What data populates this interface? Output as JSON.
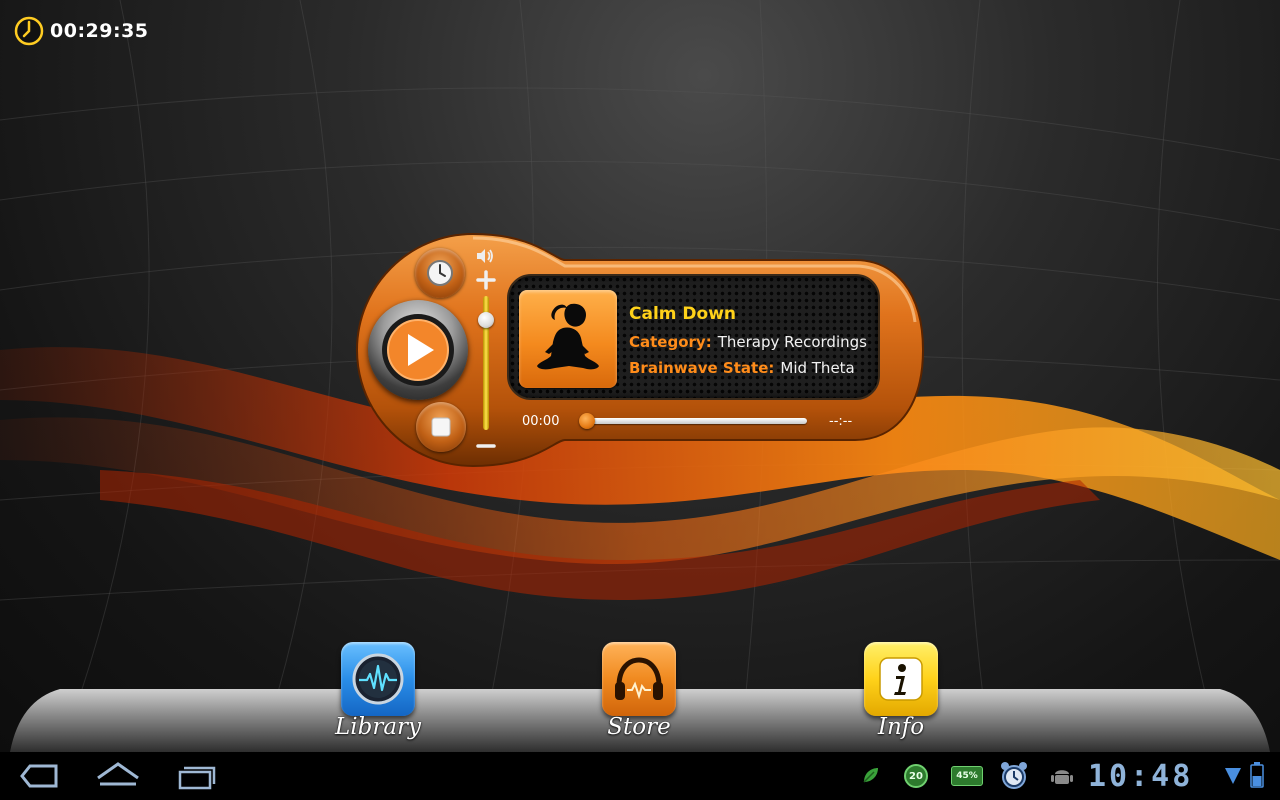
{
  "session": {
    "timer": "00:29:35",
    "timer_icon": "clock-icon"
  },
  "player": {
    "title": "Calm Down",
    "category_label": "Category:",
    "category_value": "Therapy Recordings",
    "brainwave_label": "Brainwave State:",
    "brainwave_value": "Mid Theta",
    "elapsed": "00:00",
    "total": "--:--",
    "progress_fraction": 0,
    "volume_fraction": 0.82,
    "colors": {
      "accent": "#f07a1a",
      "title": "#ffd21a",
      "label": "#ff8c1a"
    },
    "icons": [
      "clock-icon",
      "play-icon",
      "stop-icon",
      "volume-icon",
      "plus-icon",
      "minus-icon",
      "meditation-silhouette-icon"
    ]
  },
  "dock": {
    "items": [
      {
        "label": "Library",
        "icon": "waveform-icon",
        "color": "#2a8ee8"
      },
      {
        "label": "Store",
        "icon": "headphones-icon",
        "color": "#f08a20"
      },
      {
        "label": "Info",
        "icon": "info-icon",
        "color": "#ffd21a"
      }
    ]
  },
  "system_bar": {
    "time": "10:48",
    "notifications": {
      "battery_badge": "20",
      "percent_badge": "45%"
    },
    "icons": [
      "back-icon",
      "home-icon",
      "recent-apps-icon",
      "leaf-icon",
      "battery-badge-icon",
      "percent-badge-icon",
      "alarm-icon",
      "android-icon",
      "wifi-icon",
      "battery-icon"
    ]
  }
}
